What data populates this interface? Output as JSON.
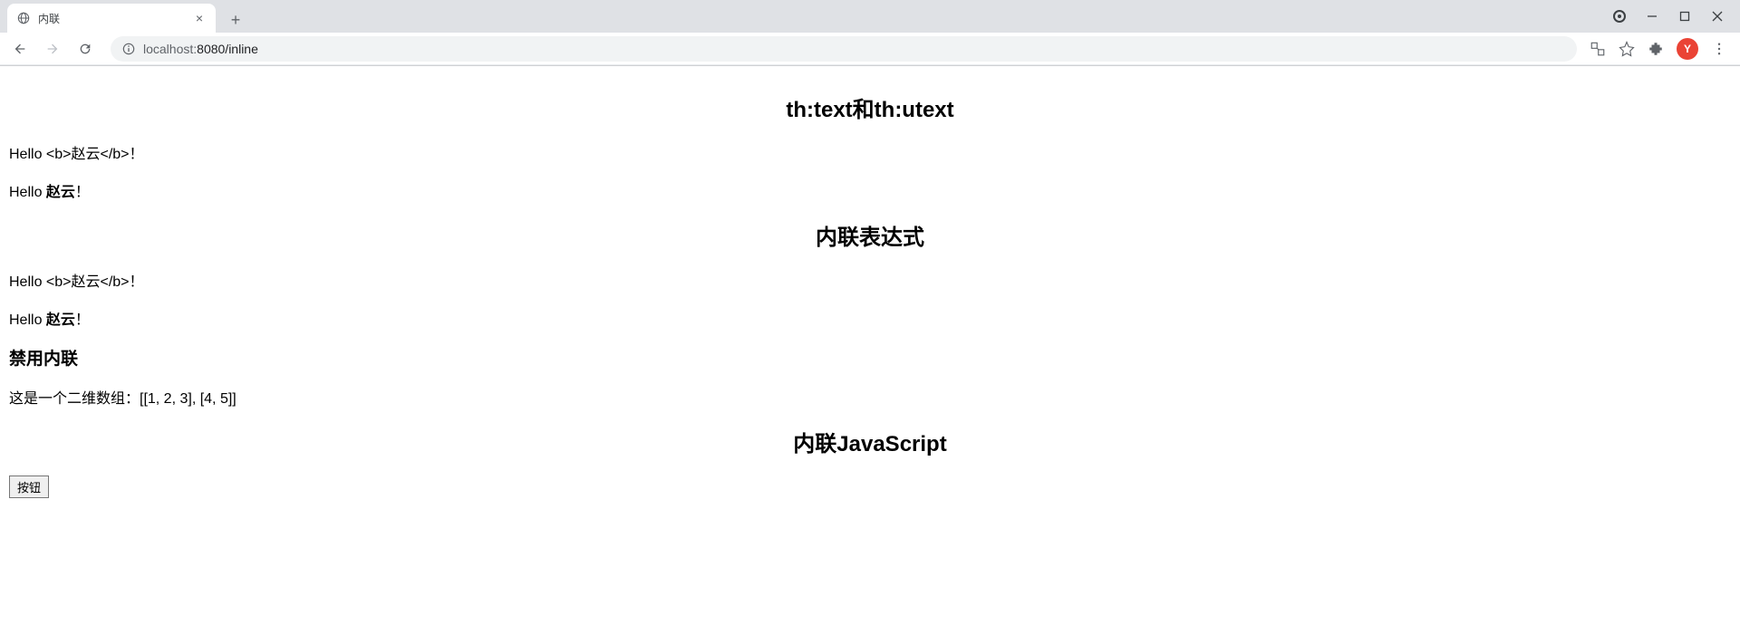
{
  "browser": {
    "tab_title": "内联",
    "url_host": "localhost:",
    "url_port_path": "8080/inline",
    "avatar_letter": "Y"
  },
  "content": {
    "h2_1": "th:text和th:utext",
    "p1_prefix": "Hello ",
    "p1_escaped": "<b>赵云</b>",
    "p1_suffix": "！",
    "p2_prefix": "Hello ",
    "p2_bold": "赵云",
    "p2_suffix": "！",
    "h2_2": "内联表达式",
    "p3_prefix": "Hello ",
    "p3_escaped": "<b>赵云</b>",
    "p3_suffix": "！",
    "p4_prefix": "Hello ",
    "p4_bold": "赵云",
    "p4_suffix": "！",
    "h3_disable": "禁用内联",
    "p5": "这是一个二维数组：[[1, 2, 3], [4, 5]]",
    "h2_3": "内联JavaScript",
    "button_label": "按钮"
  }
}
